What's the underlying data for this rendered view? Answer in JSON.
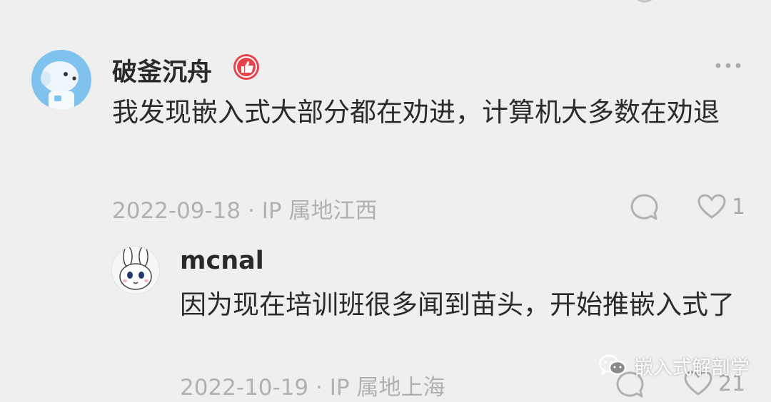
{
  "comment": {
    "author": "破釜沉舟",
    "text": "我发现嵌入式大部分都在劝进，计算机大多数在劝退",
    "date": "2022-09-18",
    "location": "IP 属地江西",
    "like_count": "1",
    "more_icon": "more-dots-icon",
    "badge_icon": "thumbs-up-badge-icon"
  },
  "reply": {
    "author": "mcnal",
    "text": "因为现在培训班很多闻到苗头，开始推嵌入式了",
    "date": "2022-10-19",
    "location": "IP 属地上海",
    "like_count": "21"
  },
  "watermark": {
    "label": "嵌入式解剖学",
    "icon": "wechat-icon"
  },
  "colors": {
    "background": "#efefef",
    "badge_red": "#e8424b",
    "meta_gray": "#b1b1b1"
  }
}
